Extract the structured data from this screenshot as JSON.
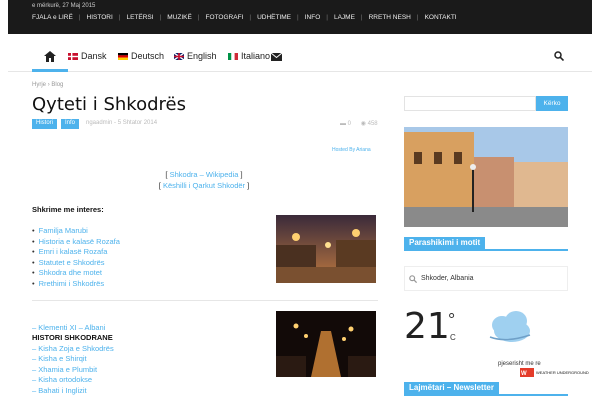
{
  "topbar": {
    "date": "e mërkurë, 27 Maj 2015",
    "menu": [
      "FJALA e LIRË",
      "HISTORI",
      "LETËRSI",
      "MUZIKË",
      "FOTOGRAFI",
      "UDHËTIME",
      "INFO",
      "LAJME",
      "RRETH NESH",
      "KONTAKTI"
    ]
  },
  "langs": [
    "Dansk",
    "Deutsch",
    "English",
    "Italiano"
  ],
  "breadcrumb": [
    "Hyrje",
    "Blog"
  ],
  "post": {
    "title": "Qyteti i Shkodrës",
    "tags": [
      "Histori",
      "Info"
    ],
    "author": "ngaadmin",
    "date": "5 Shtator 2014",
    "comments": "0",
    "views": "458",
    "hosted": "Hosted By Ariana",
    "link1": "Shkodra – Wikipedia",
    "link2": "Këshilli i Qarkut Shkodër",
    "subhead": "Shkrime me interes",
    "list1": [
      "Familja Marubi",
      "Historia e kalasë Rozafa",
      "Emri i kalasë Rozafa",
      "Statutet e Shkodrës",
      "Shkodra dhe motet",
      "Rrethimi i Shkodrës"
    ],
    "clement": "– Klementi XI – Albani",
    "histhead": "HISTORI SHKODRANE",
    "list2": [
      "– Kisha Zoja e Shkodrës",
      "– Kisha e Shirqit",
      "– Xhamia e Plumbit",
      "– Kisha ortodokse",
      "– Bahati i Inglizit"
    ]
  },
  "sidebar": {
    "search_label": "Kërko",
    "weather_title": "Parashikimi i motit",
    "location": "Shkoder, Albania",
    "temp": "21",
    "deg": "°",
    "unit": "C",
    "powered": "pjeserisht me re",
    "wu_text": "WEATHER UNDERGROUND",
    "newsletter_title": "Lajmëtari – Newsletter"
  }
}
